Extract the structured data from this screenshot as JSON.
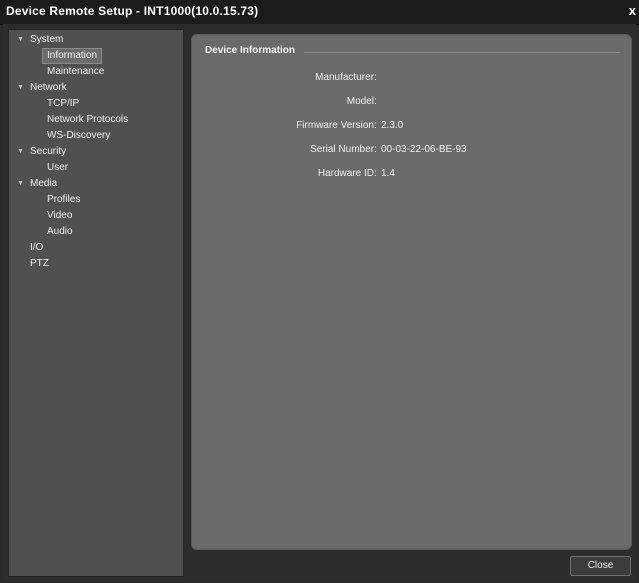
{
  "window": {
    "title": "Device Remote Setup - INT1000(10.0.15.73)",
    "close_glyph": "x"
  },
  "sidebar": {
    "items": [
      {
        "label": "System",
        "level": 0,
        "expanded": true
      },
      {
        "label": "Information",
        "level": 1,
        "selected": true
      },
      {
        "label": "Maintenance",
        "level": 1
      },
      {
        "label": "Network",
        "level": 0,
        "expanded": true
      },
      {
        "label": "TCP/IP",
        "level": 1
      },
      {
        "label": "Network Protocols",
        "level": 1
      },
      {
        "label": "WS-Discovery",
        "level": 1
      },
      {
        "label": "Security",
        "level": 0,
        "expanded": true
      },
      {
        "label": "User",
        "level": 1
      },
      {
        "label": "Media",
        "level": 0,
        "expanded": true
      },
      {
        "label": "Profiles",
        "level": 1
      },
      {
        "label": "Video",
        "level": 1
      },
      {
        "label": "Audio",
        "level": 1
      },
      {
        "label": "I/O",
        "level": 0
      },
      {
        "label": "PTZ",
        "level": 0
      }
    ]
  },
  "content": {
    "section_title": "Device Information",
    "fields": [
      {
        "label": "Manufacturer",
        "value": ""
      },
      {
        "label": "Model",
        "value": ""
      },
      {
        "label": "Firmware Version",
        "value": "2.3.0"
      },
      {
        "label": "Serial Number",
        "value": "00-03-22-06-BE-93"
      },
      {
        "label": "Hardware ID",
        "value": "1.4"
      }
    ]
  },
  "footer": {
    "close_label": "Close"
  },
  "colors": {
    "sidebar_bg": "#505050",
    "content_bg": "#6a6a6a",
    "titlebar_bg": "#1b1b1b"
  }
}
